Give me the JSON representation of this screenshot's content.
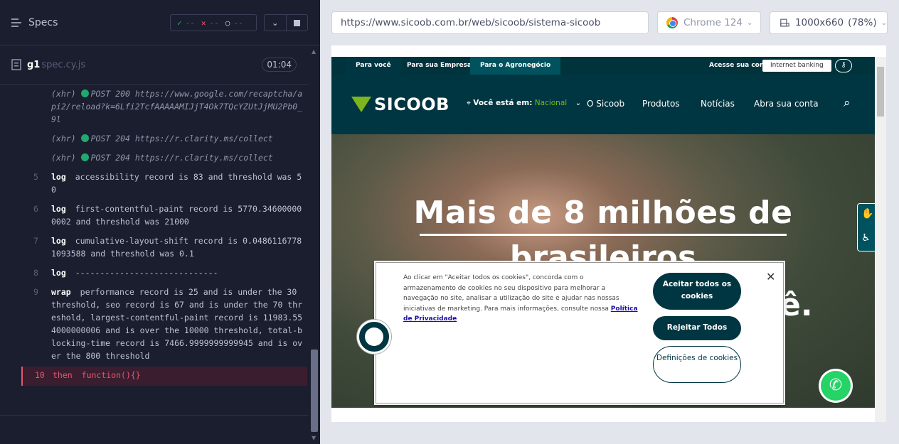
{
  "runner": {
    "title": "Specs",
    "stats": {
      "passed": "--",
      "failed": "--",
      "pending": "--"
    },
    "file": {
      "name": "g1",
      "ext": "spec.cy.js",
      "time": "01:04"
    },
    "commands": [
      {
        "num": "",
        "type": "xhr",
        "label": "(xhr)",
        "text": "POST 200 https://www.google.com/recaptcha/api2/reload?k=6Lfi2TcfAAAAAMIJjT4Ok7TQcYZUtJjMU2Pb0_9l"
      },
      {
        "num": "",
        "type": "xhr",
        "label": "(xhr)",
        "text": "POST 204 https://r.clarity.ms/collect"
      },
      {
        "num": "",
        "type": "xhr",
        "label": "(xhr)",
        "text": "POST 204 https://r.clarity.ms/collect"
      },
      {
        "num": "5",
        "type": "log",
        "label": "log",
        "text": "accessibility record is 83 and threshold was 50"
      },
      {
        "num": "6",
        "type": "log",
        "label": "log",
        "text": "first-contentful-paint record is 5770.346000000002 and threshold was 21000"
      },
      {
        "num": "7",
        "type": "log",
        "label": "log",
        "text": "cumulative-layout-shift record is 0.04861167781093588 and threshold was 0.1"
      },
      {
        "num": "8",
        "type": "log",
        "label": "log",
        "text": "-----------------------------"
      },
      {
        "num": "9",
        "type": "wrap",
        "label": "wrap",
        "text": "performance record is 25 and is under the 30 threshold, seo record is 67 and is under the 70 threshold, largest-contentful-paint record is 11983.554000000006 and is over the 10000 threshold, total-blocking-time record is 7466.9999999999945 and is over the 800 threshold"
      },
      {
        "num": "10",
        "type": "err",
        "label": "then",
        "text": "function(){}"
      }
    ]
  },
  "browser": {
    "url": "https://www.sicoob.com.br/web/sicoob/sistema-sicoob",
    "name": "Chrome 124",
    "viewport": "1000x660",
    "zoom": "(78%)"
  },
  "site": {
    "topnav": [
      "Para você",
      "Para sua Empresa",
      "Para o Agronegócio"
    ],
    "account": "Acesse sua conta",
    "banking": "Internet banking",
    "logo": "SICOOB",
    "location_label": "Você está em:",
    "location_value": "Nacional",
    "menu": [
      "O Sicoob",
      "Produtos",
      "Notícias",
      "Abra sua conta"
    ],
    "hero_line1": "Mais de 8 milhões de",
    "hero_line2": "brasileiros",
    "hero_tail": "ê."
  },
  "cookie": {
    "text": "Ao clicar em \"Aceitar todos os cookies\", concorda com o armazenamento de cookies no seu dispositivo para melhorar a navegação no site, analisar a utilização do site e ajudar nas nossas iniciativas de marketing. Para mais informações, consulte nossa",
    "link": "Política de Privacidade",
    "accept": "Aceitar todos os cookies",
    "reject": "Rejeitar Todos",
    "settings": "Definições de cookies"
  }
}
